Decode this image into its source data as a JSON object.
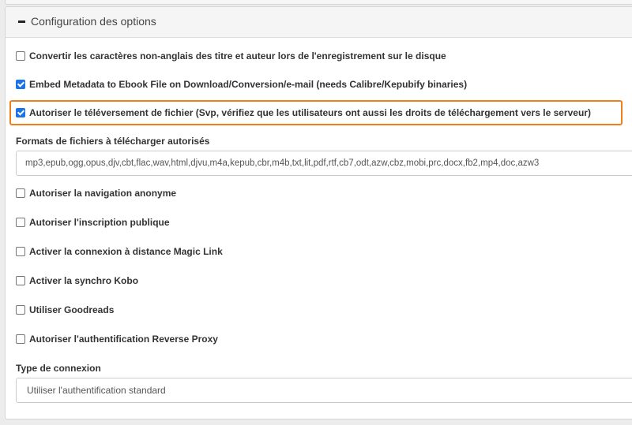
{
  "section": {
    "title": "Configuration des options"
  },
  "options": [
    {
      "label": "Convertir les caractères non-anglais des titre et auteur lors de l'enregistrement sur le disque",
      "checked": false
    },
    {
      "label": "Embed Metadata to Ebook File on Download/Conversion/e-mail (needs Calibre/Kepubify binaries)",
      "checked": true
    },
    {
      "label": "Autoriser le téléversement de fichier (Svp, vérifiez que les utilisateurs ont aussi les droits de téléchargement vers le serveur)",
      "checked": true
    }
  ],
  "upload_formats": {
    "label": "Formats de fichiers à télécharger autorisés",
    "value": "mp3,epub,ogg,opus,djv,cbt,flac,wav,html,djvu,m4a,kepub,cbr,m4b,txt,lit,pdf,rtf,cb7,odt,azw,cbz,mobi,prc,docx,fb2,mp4,doc,azw3"
  },
  "more_options": [
    {
      "label": "Autoriser la navigation anonyme",
      "checked": false
    },
    {
      "label": "Autoriser l'inscription publique",
      "checked": false
    },
    {
      "label": "Activer la connexion à distance Magic Link",
      "checked": false
    },
    {
      "label": "Activer la synchro Kobo",
      "checked": false
    },
    {
      "label": "Utiliser Goodreads",
      "checked": false
    },
    {
      "label": "Autoriser l'authentification Reverse Proxy",
      "checked": false
    }
  ],
  "login_type": {
    "label": "Type de connexion",
    "selected": "Utiliser l'authentification standard"
  },
  "colors": {
    "highlight": "#f07f1b",
    "checkbox_checked": "#1a73e8"
  }
}
